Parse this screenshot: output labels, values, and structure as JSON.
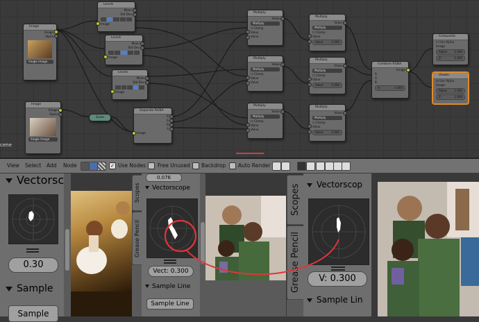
{
  "editor": {
    "scene_label": "cene",
    "nodes": {
      "image1": {
        "title": "Image",
        "out1": "Image",
        "out2": "Alpha",
        "mode": "Single Image"
      },
      "image2": {
        "title": "Image",
        "out1": "Image",
        "out2": "Alpha",
        "mode": "Single Image"
      },
      "levels1": {
        "title": "Levels",
        "out1": "Mean",
        "out2": "Std Dev",
        "in1": "Image"
      },
      "levels2": {
        "title": "Levels",
        "out1": "Mean",
        "out2": "Std Dev",
        "in1": "Image"
      },
      "levels3": {
        "title": "Levels",
        "out1": "Mean",
        "out2": "Std Dev",
        "in1": "Image"
      },
      "scale": {
        "title": "Scale"
      },
      "separate": {
        "title": "Separate RGBA",
        "out_r": "R",
        "out_g": "G",
        "out_b": "B",
        "out_a": "A",
        "in1": "Image"
      },
      "multiply": {
        "title": "Multiply",
        "out": "Value",
        "op": "Multiply",
        "clamp": "Clamp",
        "in1": "Value",
        "in2": "Value",
        "value_label": "Value:",
        "value": "2.000"
      },
      "combine": {
        "title": "Combine RGBA",
        "out": "Image",
        "r": "R",
        "g": "G",
        "b": "B",
        "a": "A:",
        "a_value": "1.000"
      },
      "composite": {
        "title": "Composite",
        "use_alpha": "Use Alpha",
        "in1": "Image",
        "alpha_label": "Alpha:",
        "alpha": "1.000",
        "z_label": "Z:",
        "z": "1.000"
      },
      "viewer": {
        "title": "Viewer",
        "use_alpha": "Use Alpha",
        "in1": "Image",
        "alpha_label": "Alpha:",
        "alpha": "1.000",
        "z_label": "Z:",
        "z": "1.000"
      }
    }
  },
  "header": {
    "view": "View",
    "select": "Select",
    "add": "Add",
    "node": "Node",
    "use_nodes": "Use Nodes",
    "free_unused": "Free Unused",
    "backdrop": "Backdrop",
    "auto_render": "Auto Render"
  },
  "left_panel": {
    "vectorscope": "Vectorsc",
    "field": "0.30",
    "sample": "Sample",
    "sample_btn": "Sample"
  },
  "middle_panel": {
    "tab_scopes": "Scopes",
    "tab_grease": "Grease Pencil",
    "top_field": "0.076",
    "vectorscope": "Vectorscope",
    "field": "Vect: 0.300",
    "sample_line": "Sample Line",
    "sample_btn": "Sample Line"
  },
  "right_panel": {
    "tab_scopes": "Scopes",
    "tab_grease": "Grease Pencil",
    "vectorscope": "Vectorscop",
    "field": "V: 0.300",
    "sample": "Sample Lin"
  },
  "colors": {
    "annotation": "#e0353a",
    "socket_yellow": "#c7c729",
    "socket_blue": "#6363c7",
    "active_outline": "#e08a2a"
  }
}
